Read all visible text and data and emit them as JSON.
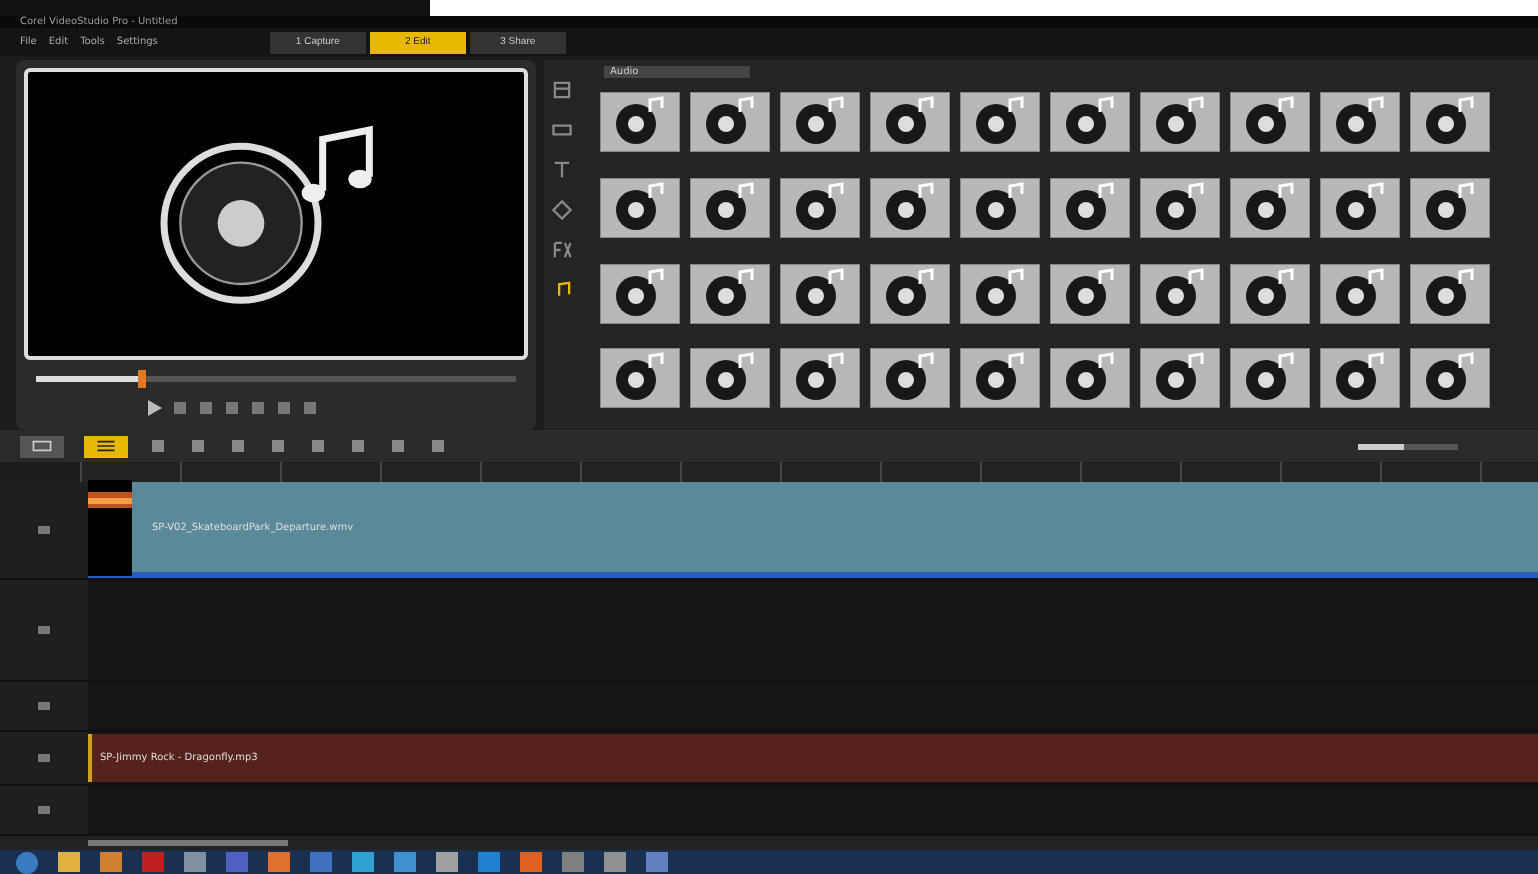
{
  "window": {
    "title": "Corel VideoStudio Pro - Untitled"
  },
  "menu": [
    "File",
    "Edit",
    "Tools",
    "Settings"
  ],
  "steps": [
    {
      "label": "1 Capture",
      "selected": false
    },
    {
      "label": "2 Edit",
      "selected": true
    },
    {
      "label": "3 Share",
      "selected": false
    }
  ],
  "preview": {
    "scrubber": {
      "level": 0.22
    }
  },
  "library": {
    "folder": "Audio",
    "categories": [
      {
        "kind": "media",
        "selected": false
      },
      {
        "kind": "transition",
        "selected": false
      },
      {
        "kind": "title",
        "selected": false
      },
      {
        "kind": "graphic",
        "selected": false
      },
      {
        "kind": "filter",
        "selected": false
      },
      {
        "kind": "audio",
        "selected": true
      }
    ],
    "items": [
      {
        "kind": "audio"
      },
      {
        "kind": "audio"
      },
      {
        "kind": "audio"
      },
      {
        "kind": "audio"
      },
      {
        "kind": "audio"
      },
      {
        "kind": "audio"
      },
      {
        "kind": "audio"
      },
      {
        "kind": "audio"
      },
      {
        "kind": "audio"
      },
      {
        "kind": "audio"
      },
      {
        "kind": "audio"
      },
      {
        "kind": "audio"
      },
      {
        "kind": "audio"
      },
      {
        "kind": "audio"
      },
      {
        "kind": "audio"
      },
      {
        "kind": "audio"
      },
      {
        "kind": "audio"
      },
      {
        "kind": "audio"
      },
      {
        "kind": "audio"
      },
      {
        "kind": "audio"
      },
      {
        "kind": "audio"
      },
      {
        "kind": "audio"
      },
      {
        "kind": "audio"
      },
      {
        "kind": "audio"
      },
      {
        "kind": "audio"
      },
      {
        "kind": "audio"
      },
      {
        "kind": "audio"
      },
      {
        "kind": "audio"
      },
      {
        "kind": "audio"
      },
      {
        "kind": "audio"
      },
      {
        "kind": "audio"
      },
      {
        "kind": "audio"
      },
      {
        "kind": "audio"
      },
      {
        "kind": "audio"
      },
      {
        "kind": "audio"
      },
      {
        "kind": "audio"
      },
      {
        "kind": "audio"
      },
      {
        "kind": "audio"
      },
      {
        "kind": "audio"
      },
      {
        "kind": "audio"
      }
    ]
  },
  "timeline": {
    "views": [
      {
        "kind": "storyboard",
        "selected": false
      },
      {
        "kind": "timeline",
        "selected": true
      }
    ],
    "zoom": {
      "level": 0.45
    },
    "tracks": [
      {
        "kind": "video",
        "clip": "SP-V02_SkateboardPark_Departure.wmv"
      },
      {
        "kind": "overlay"
      },
      {
        "kind": "title"
      },
      {
        "kind": "music",
        "clip": "SP-Jimmy Rock - Dragonfly.mp3"
      },
      {
        "kind": "voice"
      }
    ]
  },
  "taskbar": {
    "apps": [
      {
        "color": "#e0b040"
      },
      {
        "color": "#d08030"
      },
      {
        "color": "#c02020"
      },
      {
        "color": "#8090a0"
      },
      {
        "color": "#5060c0"
      },
      {
        "color": "#e07030"
      },
      {
        "color": "#4070c0"
      },
      {
        "color": "#30a0d0"
      },
      {
        "color": "#4090d0"
      },
      {
        "color": "#a0a0a0"
      },
      {
        "color": "#2080d0"
      },
      {
        "color": "#e06020"
      },
      {
        "color": "#808080"
      },
      {
        "color": "#909090"
      },
      {
        "color": "#6080c0"
      }
    ]
  }
}
